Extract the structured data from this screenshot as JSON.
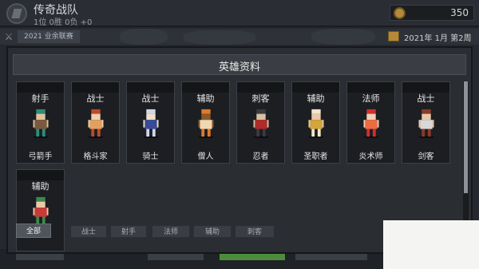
{
  "top": {
    "team_name": "传奇战队",
    "record": "1位 0胜 0负 +0",
    "gold": "350",
    "league": "2021 业余联赛",
    "date": "2021年 1月 第2周"
  },
  "dialog": {
    "title": "英雄资料",
    "heroes": [
      {
        "role": "射手",
        "name": "弓箭手",
        "sprite": "archer-sprite",
        "palette": [
          "#2f8c7a",
          "#7a5a3c",
          "#e1c0a0"
        ]
      },
      {
        "role": "战士",
        "name": "格斗家",
        "sprite": "fighter-sprite",
        "palette": [
          "#c04a28",
          "#e2a060",
          "#f0d0b0"
        ]
      },
      {
        "role": "战士",
        "name": "骑士",
        "sprite": "knight-sprite",
        "palette": [
          "#cfd8e8",
          "#3a4a9a",
          "#f0e0c8"
        ]
      },
      {
        "role": "辅助",
        "name": "僧人",
        "sprite": "monk-sprite",
        "palette": [
          "#e07a2a",
          "#f0d8b0",
          "#8a5a2a"
        ]
      },
      {
        "role": "刺客",
        "name": "忍者",
        "sprite": "ninja-sprite",
        "palette": [
          "#3a3a42",
          "#b02a2a",
          "#d8c0a0"
        ]
      },
      {
        "role": "辅助",
        "name": "圣职者",
        "sprite": "cleric-sprite",
        "palette": [
          "#f0e6c8",
          "#d4a53a",
          "#e8c8a8"
        ]
      },
      {
        "role": "法师",
        "name": "炎术师",
        "sprite": "pyromancer-sprite",
        "palette": [
          "#d03030",
          "#f06a40",
          "#f0d0b8"
        ]
      },
      {
        "role": "战士",
        "name": "剑客",
        "sprite": "swordsman-sprite",
        "palette": [
          "#8a3a2a",
          "#d8d8d8",
          "#e8c8a8"
        ]
      },
      {
        "role": "辅助",
        "name": "",
        "sprite": "dancer-sprite",
        "palette": [
          "#3a8a4a",
          "#c83a3a",
          "#f0c8a8"
        ]
      }
    ],
    "filters": [
      "全部",
      "战士",
      "射手",
      "法师",
      "辅助",
      "刺客"
    ],
    "active_filter": "全部"
  }
}
